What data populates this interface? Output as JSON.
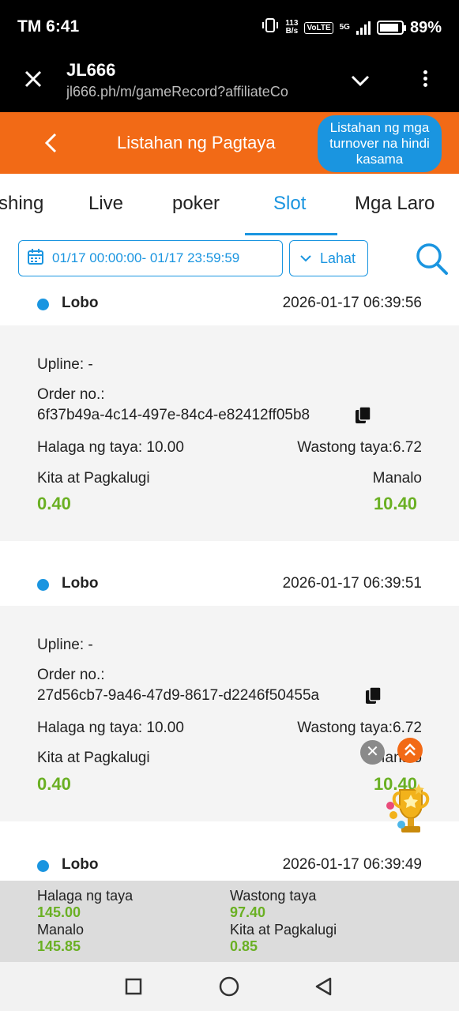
{
  "status_bar": {
    "time": "TM 6:41",
    "net_speed_top": "113",
    "net_speed_bottom": "B/s",
    "volte": "VoLTE",
    "network": "5G",
    "battery": "89%",
    "battery_level": 0.89
  },
  "browser": {
    "title": "JL666",
    "url": "jl666.ph/m/gameRecord?affiliateCo",
    "icons": [
      "close-icon",
      "chevron-down-icon",
      "more-vert-icon"
    ]
  },
  "header": {
    "title": "Listahan ng Pagtaya",
    "turnover_button": "Listahan ng mga turnover na hindi kasama",
    "color": "#f26a16",
    "accent": "#1a95e0"
  },
  "tabs": [
    {
      "label": "Fishing",
      "active": false
    },
    {
      "label": "Live",
      "active": false
    },
    {
      "label": "poker",
      "active": false
    },
    {
      "label": "Slot",
      "active": true
    },
    {
      "label": "Mga Laro",
      "active": false
    }
  ],
  "filter": {
    "date_range": "01/17 00:00:00- 01/17 23:59:59",
    "status_select": "Lahat"
  },
  "records": [
    {
      "game": "Lobo",
      "time": "2026-01-17 06:39:56",
      "upline": "Upline: -",
      "order_label": "Order no.:",
      "order_no": "6f37b49a-4c14-497e-84c4-e82412ff05b8",
      "bet_amount": "Halaga ng taya: 10.00",
      "valid_bet": "Wastong taya:6.72",
      "profit_label": "Kita at Pagkalugi",
      "profit_value": "0.40",
      "win_label": "Manalo",
      "win_value": "10.40"
    },
    {
      "game": "Lobo",
      "time": "2026-01-17 06:39:51",
      "upline": "Upline: -",
      "order_label": "Order no.:",
      "order_no": "27d56cb7-9a46-47d9-8617-d2246f50455a",
      "bet_amount": "Halaga ng taya: 10.00",
      "valid_bet": "Wastong taya:6.72",
      "profit_label": "Kita at Pagkalugi",
      "profit_value": "0.40",
      "win_label": "Manalo",
      "win_value": "10.40"
    },
    {
      "game": "Lobo",
      "time": "2026-01-17 06:39:49"
    }
  ],
  "summary": {
    "bet_label": "Halaga ng taya",
    "bet_value": "145.00",
    "valid_label": "Wastong taya",
    "valid_value": "97.40",
    "win_label": "Manalo",
    "win_value": "145.85",
    "profit_label": "Kita at Pagkalugi",
    "profit_value": "0.85"
  },
  "floating": {
    "close_symbol": "✕",
    "icons": [
      "close-icon",
      "scroll-top-icon",
      "trophy-icon"
    ]
  },
  "nav_bar": {
    "icons": [
      "recents-icon",
      "home-icon",
      "back-icon"
    ]
  }
}
